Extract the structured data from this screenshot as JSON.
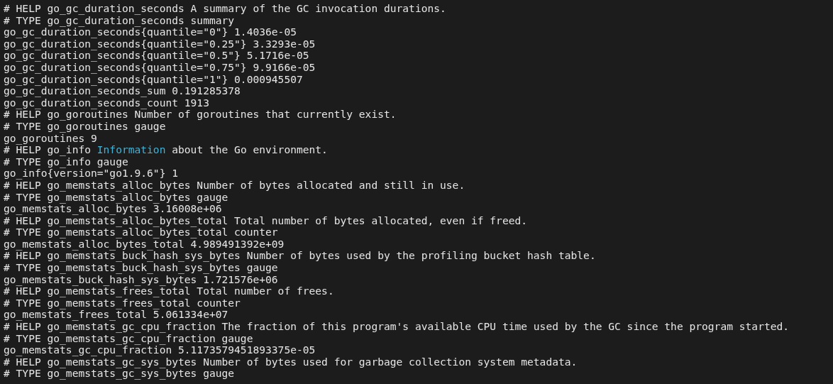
{
  "terminal": {
    "lines": [
      {
        "text": "# HELP go_gc_duration_seconds A summary of the GC invocation durations."
      },
      {
        "text": "# TYPE go_gc_duration_seconds summary"
      },
      {
        "text": "go_gc_duration_seconds{quantile=\"0\"} 1.4036e-05"
      },
      {
        "text": "go_gc_duration_seconds{quantile=\"0.25\"} 3.3293e-05"
      },
      {
        "text": "go_gc_duration_seconds{quantile=\"0.5\"} 5.1716e-05"
      },
      {
        "text": "go_gc_duration_seconds{quantile=\"0.75\"} 9.9166e-05"
      },
      {
        "text": "go_gc_duration_seconds{quantile=\"1\"} 0.000945507"
      },
      {
        "text": "go_gc_duration_seconds_sum 0.191285378"
      },
      {
        "text": "go_gc_duration_seconds_count 1913"
      },
      {
        "text": "# HELP go_goroutines Number of goroutines that currently exist."
      },
      {
        "text": "# TYPE go_goroutines gauge"
      },
      {
        "text": "go_goroutines 9"
      },
      {
        "parts": [
          {
            "text": "# HELP go_info ",
            "highlight": false
          },
          {
            "text": "Information",
            "highlight": true
          },
          {
            "text": " about the Go environment.",
            "highlight": false
          }
        ]
      },
      {
        "text": "# TYPE go_info gauge"
      },
      {
        "text": "go_info{version=\"go1.9.6\"} 1"
      },
      {
        "text": "# HELP go_memstats_alloc_bytes Number of bytes allocated and still in use."
      },
      {
        "text": "# TYPE go_memstats_alloc_bytes gauge"
      },
      {
        "text": "go_memstats_alloc_bytes 3.16008e+06"
      },
      {
        "text": "# HELP go_memstats_alloc_bytes_total Total number of bytes allocated, even if freed."
      },
      {
        "text": "# TYPE go_memstats_alloc_bytes_total counter"
      },
      {
        "text": "go_memstats_alloc_bytes_total 4.989491392e+09"
      },
      {
        "text": "# HELP go_memstats_buck_hash_sys_bytes Number of bytes used by the profiling bucket hash table."
      },
      {
        "text": "# TYPE go_memstats_buck_hash_sys_bytes gauge"
      },
      {
        "text": "go_memstats_buck_hash_sys_bytes 1.721576e+06"
      },
      {
        "text": "# HELP go_memstats_frees_total Total number of frees."
      },
      {
        "text": "# TYPE go_memstats_frees_total counter"
      },
      {
        "text": "go_memstats_frees_total 5.061334e+07"
      },
      {
        "text": "# HELP go_memstats_gc_cpu_fraction The fraction of this program's available CPU time used by the GC since the program started."
      },
      {
        "text": "# TYPE go_memstats_gc_cpu_fraction gauge"
      },
      {
        "text": "go_memstats_gc_cpu_fraction 5.1173579451893375e-05"
      },
      {
        "text": "# HELP go_memstats_gc_sys_bytes Number of bytes used for garbage collection system metadata."
      },
      {
        "text": "# TYPE go_memstats_gc_sys_bytes gauge"
      }
    ]
  }
}
